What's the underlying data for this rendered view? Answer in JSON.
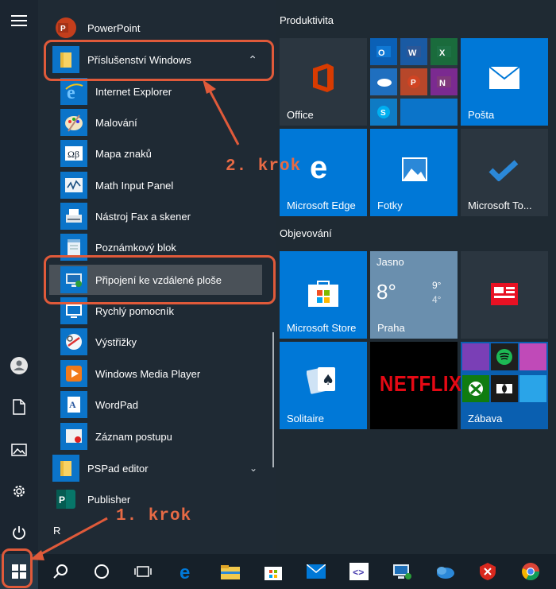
{
  "apps": [
    {
      "label": "PowerPoint",
      "icon": "powerpoint-icon",
      "type": "app"
    },
    {
      "label": "Příslušenství Windows",
      "icon": "folder-icon",
      "type": "folder",
      "chevron": "^"
    },
    {
      "label": "Internet Explorer",
      "icon": "internet-explorer-icon",
      "type": "sub"
    },
    {
      "label": "Malování",
      "icon": "paint-icon",
      "type": "sub"
    },
    {
      "label": "Mapa znaků",
      "icon": "character-map-icon",
      "type": "sub"
    },
    {
      "label": "Math Input Panel",
      "icon": "math-input-icon",
      "type": "sub"
    },
    {
      "label": "Nástroj Fax a skener",
      "icon": "fax-scanner-icon",
      "type": "sub"
    },
    {
      "label": "Poznámkový blok",
      "icon": "notepad-icon",
      "type": "sub"
    },
    {
      "label": "Připojení ke vzdálené ploše",
      "icon": "remote-desktop-icon",
      "type": "sub"
    },
    {
      "label": "Rychlý pomocník",
      "icon": "quick-assist-icon",
      "type": "sub"
    },
    {
      "label": "Výstřižky",
      "icon": "snipping-tool-icon",
      "type": "sub"
    },
    {
      "label": "Windows Media Player",
      "icon": "media-player-icon",
      "type": "sub"
    },
    {
      "label": "WordPad",
      "icon": "wordpad-icon",
      "type": "sub"
    },
    {
      "label": "Záznam postupu",
      "icon": "steps-recorder-icon",
      "type": "sub"
    },
    {
      "label": "PSPad editor",
      "icon": "folder-icon",
      "type": "folder",
      "chevron": "v"
    },
    {
      "label": "Publisher",
      "icon": "publisher-icon",
      "type": "app"
    }
  ],
  "section_r": "R",
  "groups": {
    "productivity": "Produktivita",
    "explore": "Objevování"
  },
  "tiles": {
    "office": "Office",
    "mail": "Pošta",
    "edge": "Microsoft Edge",
    "photos": "Fotky",
    "todo": "Microsoft To...",
    "store": "Microsoft Store",
    "solitaire": "Solitaire",
    "netflix": "NETFLIX",
    "entertainment": "Zábava"
  },
  "weather": {
    "condition": "Jasno",
    "temp": "8°",
    "high": "9°",
    "low": "4°",
    "city": "Praha"
  },
  "annotations": {
    "step1": "1. krok",
    "step2": "2. krok"
  },
  "colors": {
    "accent": "#0078d7",
    "annotation": "#e05a3a"
  }
}
